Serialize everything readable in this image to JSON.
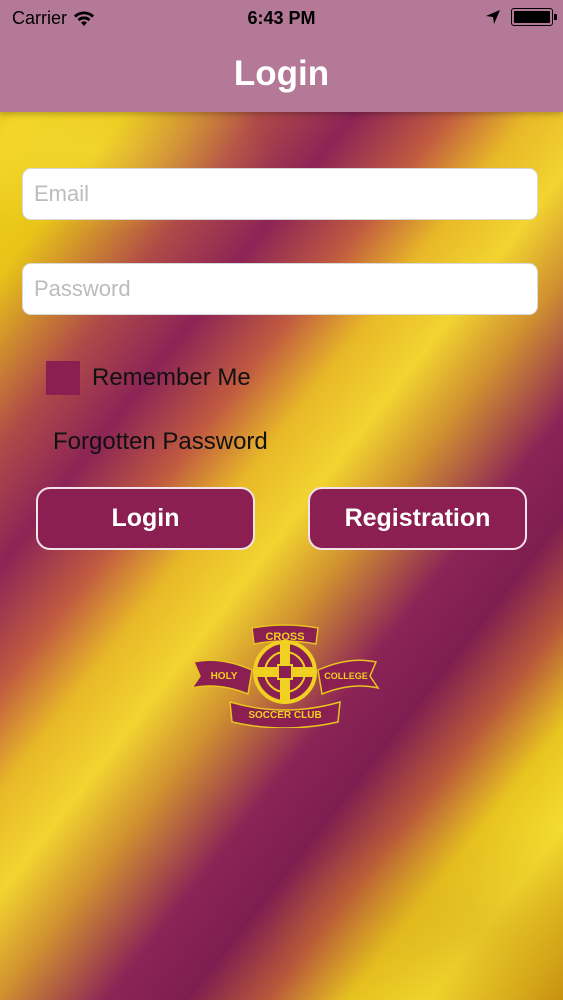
{
  "status_bar": {
    "carrier": "Carrier",
    "time": "6:43 PM",
    "icons": [
      "wifi-icon",
      "location-arrow-icon",
      "battery-icon"
    ]
  },
  "nav": {
    "title": "Login"
  },
  "form": {
    "email": {
      "value": "",
      "placeholder": "Email"
    },
    "password": {
      "value": "",
      "placeholder": "Password"
    },
    "remember_label": "Remember Me",
    "remember_checked": true,
    "forgot_label": "Forgotten Password"
  },
  "buttons": {
    "login_label": "Login",
    "registration_label": "Registration"
  },
  "logo": {
    "top_text": "CROSS",
    "left_text": "HOLY",
    "right_text": "COLLEGE",
    "bottom_text": "SOCCER CLUB"
  },
  "colors": {
    "nav_bg": "#b37997",
    "accent_maroon": "#8c1f52",
    "gold": "#f0d020"
  }
}
